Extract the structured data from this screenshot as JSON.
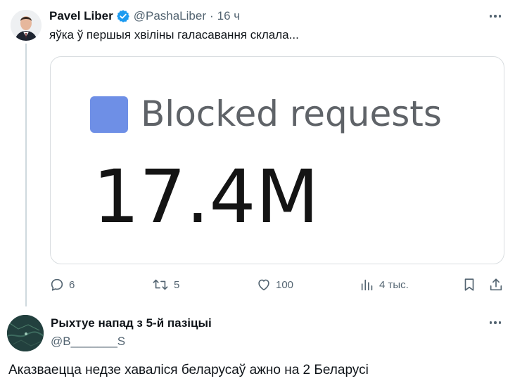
{
  "tweet": {
    "author_name": "Pavel Liber",
    "handle": "@PashaLiber",
    "separator": "·",
    "time": "16 ч",
    "text": "яўка ў першыя хвіліны галасавання склала...",
    "media": {
      "label": "Blocked requests",
      "value": "17.4M",
      "swatch_color": "#6e8fe6"
    },
    "actions": {
      "replies": "6",
      "retweets": "5",
      "likes": "100",
      "views": "4 тыс."
    }
  },
  "reply": {
    "author_name": "Рыхтуе напад з 5-й пазіцыі",
    "handle": "@B_______S",
    "text": "Аказваецца недзе хаваліся беларусаў ажно на 2 Беларусі"
  },
  "colors": {
    "text": "#0f1419",
    "secondary": "#536471",
    "verified": "#1d9bf0",
    "border": "#d9dde0"
  },
  "icons": [
    "verified-badge-icon",
    "more-icon",
    "reply-icon",
    "retweet-icon",
    "like-icon",
    "views-icon",
    "bookmark-icon",
    "share-icon"
  ]
}
